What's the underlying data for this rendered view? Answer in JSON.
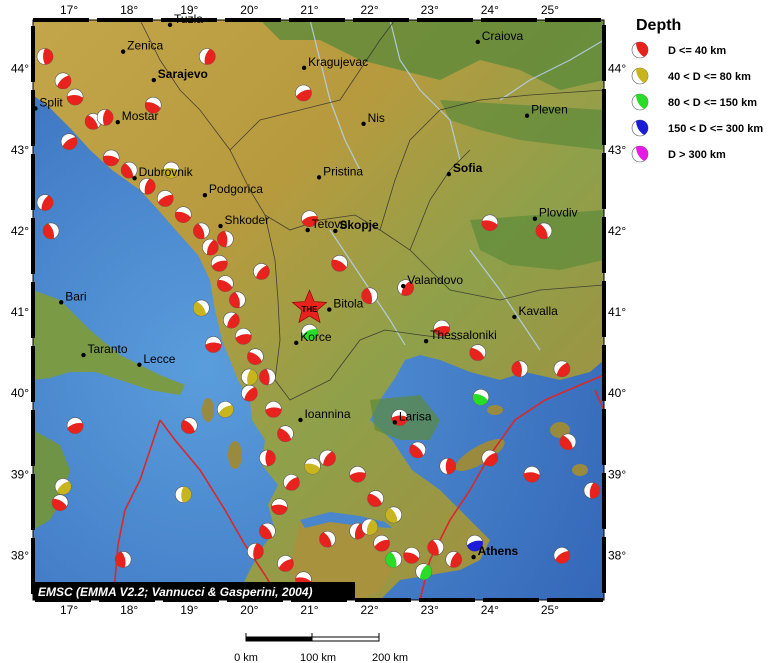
{
  "map": {
    "lon_range": [
      16.4,
      25.9
    ],
    "lat_range": [
      37.45,
      44.6
    ],
    "lon_ticks": [
      {
        "value": 17,
        "label": "17°"
      },
      {
        "value": 18,
        "label": "18°"
      },
      {
        "value": 19,
        "label": "19°"
      },
      {
        "value": 20,
        "label": "20°"
      },
      {
        "value": 21,
        "label": "21°"
      },
      {
        "value": 22,
        "label": "22°"
      },
      {
        "value": 23,
        "label": "23°"
      },
      {
        "value": 24,
        "label": "24°"
      },
      {
        "value": 25,
        "label": "25°"
      }
    ],
    "lat_ticks": [
      {
        "value": 38,
        "label": "38°"
      },
      {
        "value": 39,
        "label": "39°"
      },
      {
        "value": 40,
        "label": "40°"
      },
      {
        "value": 41,
        "label": "41°"
      },
      {
        "value": 42,
        "label": "42°"
      },
      {
        "value": 43,
        "label": "43°"
      },
      {
        "value": 44,
        "label": "44°"
      }
    ],
    "colors": {
      "sea": "#4a8fd2",
      "sea_deep": "#3a6fc0",
      "land_low": "#4f8a3a",
      "land_mid": "#b5a24a",
      "land_high": "#c9903a",
      "border": "#333333",
      "river": "#a8c8e8",
      "plate_boundary": "#d8282a"
    }
  },
  "cities": [
    {
      "name": "Tuzla",
      "lon": 18.68,
      "lat": 44.54,
      "bold": false
    },
    {
      "name": "Zenica",
      "lon": 17.9,
      "lat": 44.21,
      "bold": false
    },
    {
      "name": "Sarajevo",
      "lon": 18.41,
      "lat": 43.86,
      "bold": true
    },
    {
      "name": "Split",
      "lon": 16.44,
      "lat": 43.51,
      "bold": false
    },
    {
      "name": "Mostar",
      "lon": 17.81,
      "lat": 43.34,
      "bold": false
    },
    {
      "name": "Dubrovnik",
      "lon": 18.09,
      "lat": 42.65,
      "bold": false
    },
    {
      "name": "Podgorica",
      "lon": 19.26,
      "lat": 42.44,
      "bold": false
    },
    {
      "name": "Shkoder",
      "lon": 19.52,
      "lat": 42.06,
      "bold": false
    },
    {
      "name": "Kragujevac",
      "lon": 20.91,
      "lat": 44.01,
      "bold": false
    },
    {
      "name": "Nis",
      "lon": 21.9,
      "lat": 43.32,
      "bold": false
    },
    {
      "name": "Pristina",
      "lon": 21.16,
      "lat": 42.66,
      "bold": false
    },
    {
      "name": "Tetovo",
      "lon": 20.97,
      "lat": 42.01,
      "bold": false
    },
    {
      "name": "Skopje",
      "lon": 21.43,
      "lat": 42.0,
      "bold": true
    },
    {
      "name": "Craiova",
      "lon": 23.8,
      "lat": 44.33,
      "bold": false
    },
    {
      "name": "Pleven",
      "lon": 24.62,
      "lat": 43.42,
      "bold": false
    },
    {
      "name": "Sofia",
      "lon": 23.32,
      "lat": 42.7,
      "bold": true
    },
    {
      "name": "Plovdiv",
      "lon": 24.75,
      "lat": 42.15,
      "bold": false
    },
    {
      "name": "Valandovo",
      "lon": 22.56,
      "lat": 41.32,
      "bold": false
    },
    {
      "name": "Bitola",
      "lon": 21.33,
      "lat": 41.03,
      "bold": false
    },
    {
      "name": "Korce",
      "lon": 20.78,
      "lat": 40.62,
      "bold": false
    },
    {
      "name": "Thessaloniki",
      "lon": 22.94,
      "lat": 40.64,
      "bold": false
    },
    {
      "name": "Kavalla",
      "lon": 24.41,
      "lat": 40.94,
      "bold": false
    },
    {
      "name": "Bari",
      "lon": 16.87,
      "lat": 41.12,
      "bold": false
    },
    {
      "name": "Taranto",
      "lon": 17.24,
      "lat": 40.47,
      "bold": false
    },
    {
      "name": "Lecce",
      "lon": 18.17,
      "lat": 40.35,
      "bold": false
    },
    {
      "name": "Ioannina",
      "lon": 20.85,
      "lat": 39.67,
      "bold": false
    },
    {
      "name": "Larisa",
      "lon": 22.42,
      "lat": 39.64,
      "bold": false
    },
    {
      "name": "Athens",
      "lon": 23.73,
      "lat": 37.98,
      "bold": true
    }
  ],
  "station": {
    "label": "THE",
    "lon": 21.0,
    "lat": 41.05
  },
  "events": [
    {
      "lon": 16.6,
      "lat": 44.15,
      "cls": 0
    },
    {
      "lon": 16.9,
      "lat": 43.85,
      "cls": 0
    },
    {
      "lon": 17.1,
      "lat": 43.65,
      "cls": 0
    },
    {
      "lon": 17.4,
      "lat": 43.35,
      "cls": 0
    },
    {
      "lon": 17.6,
      "lat": 43.4,
      "cls": 0
    },
    {
      "lon": 17.0,
      "lat": 43.1,
      "cls": 0
    },
    {
      "lon": 17.7,
      "lat": 42.9,
      "cls": 0
    },
    {
      "lon": 18.0,
      "lat": 42.75,
      "cls": 0
    },
    {
      "lon": 18.3,
      "lat": 42.55,
      "cls": 0
    },
    {
      "lon": 18.6,
      "lat": 42.4,
      "cls": 0
    },
    {
      "lon": 18.9,
      "lat": 42.2,
      "cls": 0
    },
    {
      "lon": 19.2,
      "lat": 42.0,
      "cls": 0
    },
    {
      "lon": 19.35,
      "lat": 41.8,
      "cls": 0
    },
    {
      "lon": 19.5,
      "lat": 41.6,
      "cls": 0
    },
    {
      "lon": 19.6,
      "lat": 41.35,
      "cls": 0
    },
    {
      "lon": 19.8,
      "lat": 41.15,
      "cls": 0
    },
    {
      "lon": 19.7,
      "lat": 40.9,
      "cls": 0
    },
    {
      "lon": 19.9,
      "lat": 40.7,
      "cls": 0
    },
    {
      "lon": 20.1,
      "lat": 40.45,
      "cls": 0
    },
    {
      "lon": 20.3,
      "lat": 40.2,
      "cls": 0
    },
    {
      "lon": 20.0,
      "lat": 40.0,
      "cls": 0
    },
    {
      "lon": 20.4,
      "lat": 39.8,
      "cls": 0
    },
    {
      "lon": 20.6,
      "lat": 39.5,
      "cls": 0
    },
    {
      "lon": 20.3,
      "lat": 39.2,
      "cls": 0
    },
    {
      "lon": 20.7,
      "lat": 38.9,
      "cls": 0
    },
    {
      "lon": 20.5,
      "lat": 38.6,
      "cls": 0
    },
    {
      "lon": 20.3,
      "lat": 38.3,
      "cls": 0
    },
    {
      "lon": 20.1,
      "lat": 38.05,
      "cls": 0
    },
    {
      "lon": 20.6,
      "lat": 37.9,
      "cls": 0
    },
    {
      "lon": 20.9,
      "lat": 37.7,
      "cls": 0
    },
    {
      "lon": 21.3,
      "lat": 38.2,
      "cls": 0
    },
    {
      "lon": 21.8,
      "lat": 38.3,
      "cls": 0
    },
    {
      "lon": 22.2,
      "lat": 38.15,
      "cls": 0
    },
    {
      "lon": 22.7,
      "lat": 38.0,
      "cls": 0
    },
    {
      "lon": 23.1,
      "lat": 38.1,
      "cls": 0
    },
    {
      "lon": 23.4,
      "lat": 37.95,
      "cls": 0
    },
    {
      "lon": 21.0,
      "lat": 42.15,
      "cls": 0
    },
    {
      "lon": 21.5,
      "lat": 41.6,
      "cls": 0
    },
    {
      "lon": 22.0,
      "lat": 41.2,
      "cls": 0
    },
    {
      "lon": 22.6,
      "lat": 41.3,
      "cls": 0
    },
    {
      "lon": 23.2,
      "lat": 40.8,
      "cls": 0
    },
    {
      "lon": 23.8,
      "lat": 40.5,
      "cls": 0
    },
    {
      "lon": 24.5,
      "lat": 40.3,
      "cls": 0
    },
    {
      "lon": 25.2,
      "lat": 40.3,
      "cls": 0
    },
    {
      "lon": 22.5,
      "lat": 39.7,
      "cls": 0
    },
    {
      "lon": 22.8,
      "lat": 39.3,
      "cls": 0
    },
    {
      "lon": 23.3,
      "lat": 39.1,
      "cls": 0
    },
    {
      "lon": 24.0,
      "lat": 39.2,
      "cls": 0
    },
    {
      "lon": 24.7,
      "lat": 39.0,
      "cls": 0
    },
    {
      "lon": 25.3,
      "lat": 39.4,
      "cls": 0
    },
    {
      "lon": 25.7,
      "lat": 38.8,
      "cls": 0
    },
    {
      "lon": 25.2,
      "lat": 38.0,
      "cls": 0
    },
    {
      "lon": 24.0,
      "lat": 42.1,
      "cls": 0
    },
    {
      "lon": 24.9,
      "lat": 42.0,
      "cls": 0
    },
    {
      "lon": 19.3,
      "lat": 44.15,
      "cls": 0
    },
    {
      "lon": 20.9,
      "lat": 43.7,
      "cls": 0
    },
    {
      "lon": 18.4,
      "lat": 43.55,
      "cls": 0
    },
    {
      "lon": 16.7,
      "lat": 42.0,
      "cls": 0
    },
    {
      "lon": 16.6,
      "lat": 42.35,
      "cls": 0
    },
    {
      "lon": 17.1,
      "lat": 39.6,
      "cls": 0
    },
    {
      "lon": 16.85,
      "lat": 38.65,
      "cls": 0
    },
    {
      "lon": 17.9,
      "lat": 37.95,
      "cls": 0
    },
    {
      "lon": 21.3,
      "lat": 39.2,
      "cls": 0
    },
    {
      "lon": 21.8,
      "lat": 39.0,
      "cls": 0
    },
    {
      "lon": 22.1,
      "lat": 38.7,
      "cls": 0
    },
    {
      "lon": 19.6,
      "lat": 41.9,
      "cls": 0
    },
    {
      "lon": 20.2,
      "lat": 41.5,
      "cls": 0
    },
    {
      "lon": 19.4,
      "lat": 40.6,
      "cls": 0
    },
    {
      "lon": 19.0,
      "lat": 39.6,
      "cls": 0
    },
    {
      "lon": 18.9,
      "lat": 38.75,
      "cls": 1
    },
    {
      "lon": 16.9,
      "lat": 38.85,
      "cls": 1
    },
    {
      "lon": 18.7,
      "lat": 42.75,
      "cls": 1
    },
    {
      "lon": 19.2,
      "lat": 41.05,
      "cls": 1
    },
    {
      "lon": 20.0,
      "lat": 40.2,
      "cls": 1
    },
    {
      "lon": 19.6,
      "lat": 39.8,
      "cls": 1
    },
    {
      "lon": 21.05,
      "lat": 39.1,
      "cls": 1
    },
    {
      "lon": 22.4,
      "lat": 38.5,
      "cls": 1
    },
    {
      "lon": 22.0,
      "lat": 38.35,
      "cls": 1
    },
    {
      "lon": 21.0,
      "lat": 40.75,
      "cls": 2
    },
    {
      "lon": 23.85,
      "lat": 39.95,
      "cls": 2
    },
    {
      "lon": 22.4,
      "lat": 37.95,
      "cls": 2
    },
    {
      "lon": 22.9,
      "lat": 37.8,
      "cls": 2
    },
    {
      "lon": 23.75,
      "lat": 38.15,
      "cls": 3
    }
  ],
  "legend": {
    "title": "Depth",
    "items": [
      {
        "label": "D <= 40 km",
        "color": "#e8221c"
      },
      {
        "label": "40 < D <= 80 km",
        "color": "#c8b41c"
      },
      {
        "label": "80 < D <= 150 km",
        "color": "#28dc28"
      },
      {
        "label": "150 < D <= 300 km",
        "color": "#1c1cd8"
      },
      {
        "label": "D > 300 km",
        "color": "#e41ce4"
      }
    ]
  },
  "scale_bar": {
    "labels": [
      "0 km",
      "100 km",
      "200 km"
    ]
  },
  "credit": "EMSC (EMMA V2.2; Vannucci & Gasperini, 2004)"
}
